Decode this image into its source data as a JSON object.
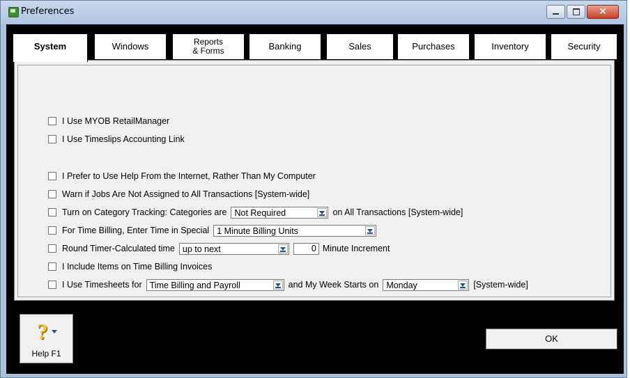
{
  "window": {
    "title": "Preferences",
    "close_symbol": "✕"
  },
  "tabs": [
    {
      "label": "System",
      "active": true
    },
    {
      "label": "Windows",
      "active": false
    },
    {
      "label": "Reports",
      "label2": "& Forms",
      "active": false
    },
    {
      "label": "Banking",
      "active": false
    },
    {
      "label": "Sales",
      "active": false
    },
    {
      "label": "Purchases",
      "active": false
    },
    {
      "label": "Inventory",
      "active": false
    },
    {
      "label": "Security",
      "active": false
    }
  ],
  "options": {
    "retail_manager": {
      "label": "I Use MYOB RetailManager",
      "checked": false
    },
    "timeslips": {
      "label": "I Use Timeslips Accounting Link",
      "checked": false
    },
    "help_internet": {
      "label": "I Prefer to Use Help From the Internet, Rather Than My Computer",
      "checked": false
    },
    "warn_jobs": {
      "label": "Warn if Jobs Are Not Assigned to All Transactions [System-wide]",
      "checked": false
    },
    "category_tracking": {
      "label": "Turn on Category Tracking:  Categories are",
      "value": "Not Required",
      "suffix": "on All Transactions [System-wide]",
      "checked": false
    },
    "time_billing": {
      "label": "For Time Billing, Enter Time in Special",
      "value": "1 Minute Billing Units",
      "checked": false
    },
    "round_timer": {
      "label": "Round Timer-Calculated time",
      "value": "up to next",
      "increment": "0",
      "suffix": "Minute Increment",
      "checked": false
    },
    "include_items": {
      "label": "I Include Items on Time Billing Invoices",
      "checked": false
    },
    "timesheets": {
      "label": "I Use Timesheets for",
      "value": "Time Billing and Payroll",
      "middle": "and My Week Starts on",
      "day": "Monday",
      "suffix": "[System-wide]",
      "checked": false
    }
  },
  "buttons": {
    "help": "Help F1",
    "ok": "OK"
  },
  "colors": {
    "client_bg": "#000000",
    "panel_bg": "#f0f0f0",
    "title_bg": "#b0c6e0",
    "close_red": "#c6412b"
  }
}
